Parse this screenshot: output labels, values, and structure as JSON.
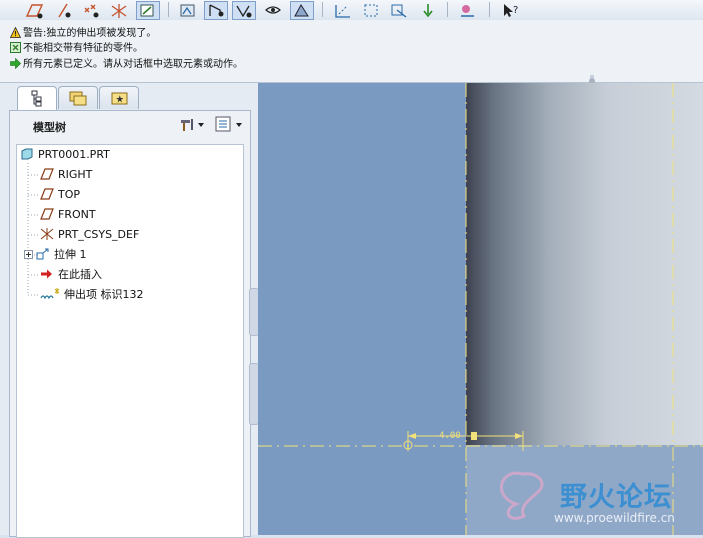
{
  "messages": [
    {
      "icon": "warning-icon",
      "text": "警告:独立的伸出项被发现了。"
    },
    {
      "icon": "info-icon",
      "text": "不能相交带有特征的零件。"
    },
    {
      "icon": "arrow-prompt-icon",
      "text": "所有元素已定义。请从对话框中选取元素或动作。"
    }
  ],
  "panel": {
    "tabs": [
      {
        "icon": "model-tree-icon",
        "selected": true
      },
      {
        "icon": "folder-browser-icon",
        "selected": false
      },
      {
        "icon": "favorites-icon",
        "selected": false
      }
    ],
    "tree_title": "模型树",
    "settings_icon": "hammer-settings-icon",
    "columns_icon": "tree-columns-icon"
  },
  "tree": [
    {
      "icon": "part-icon",
      "label": "PRT0001.PRT"
    },
    {
      "icon": "datum-plane-icon",
      "label": "RIGHT"
    },
    {
      "icon": "datum-plane-icon",
      "label": "TOP"
    },
    {
      "icon": "datum-plane-icon",
      "label": "FRONT"
    },
    {
      "icon": "csys-icon",
      "label": "PRT_CSYS_DEF"
    },
    {
      "icon": "extrude-icon",
      "label": "拉伸 1"
    },
    {
      "icon": "insert-here-icon",
      "label": "在此插入"
    },
    {
      "icon": "protrusion-icon",
      "label": "伸出项 标识132"
    }
  ],
  "graphics": {
    "dimension": "4.00",
    "watermark_cn": "野火论坛",
    "watermark_url": "www.proewildfire.cn"
  },
  "colors": {
    "background": "#7b9ac2",
    "datum_line": "#f2e17a",
    "accent": "#3c8fd0"
  }
}
